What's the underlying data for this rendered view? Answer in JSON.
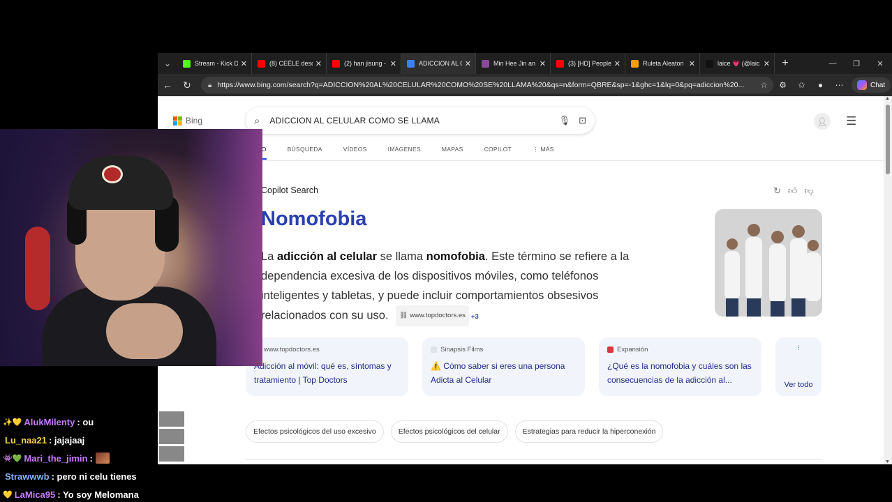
{
  "browser": {
    "tabs": [
      {
        "label": "Stream - Kick D",
        "color": "#53fc18",
        "active": false
      },
      {
        "label": "(8) CEÉLE descu",
        "color": "#ff0000",
        "active": false
      },
      {
        "label": "(2) han jisung -",
        "color": "#ff0000",
        "active": false
      },
      {
        "label": "ADICCION AL C",
        "color": "#3b82f6",
        "active": true
      },
      {
        "label": "Min Hee Jin an",
        "color": "#8a4a9a",
        "active": false
      },
      {
        "label": "(3) [HD] People",
        "color": "#ff0000",
        "active": false
      },
      {
        "label": "Ruleta Aleatori",
        "color": "#f59e0b",
        "active": false
      },
      {
        "label": "laice 💗 (@laic",
        "color": "#111111",
        "active": false
      }
    ],
    "url": "https://www.bing.com/search?q=ADICCION%20AL%20CELULAR%20COMO%20SE%20LLAMA%20&qs=n&form=QBRE&sp=-1&ghc=1&lq=0&pq=adiccion%20...",
    "chat_label": "Chat"
  },
  "bing": {
    "logo_text": "Bing",
    "query": "ADICCION AL CELULAR COMO SE LLAMA",
    "scopes": [
      "TODO",
      "BÚSQUEDA",
      "VÍDEOS",
      "IMÁGENES",
      "MAPAS",
      "COPILOT",
      "⋮ MÁS"
    ],
    "copilot_label": "Copilot Search",
    "answer_title": "Nomofobia",
    "answer_p1": "La ",
    "answer_b1": "adicción al celular",
    "answer_p2": " se llama ",
    "answer_b2": "nomofobia",
    "answer_p3": ". Este término se refiere a la dependencia excesiva de los dispositivos móviles, como teléfonos inteligentes y tabletas, y puede incluir comportamientos obsesivos relacionados con su uso.",
    "answer_source": "www.topdoctors.es",
    "answer_source_more": "+3",
    "cards": [
      {
        "source": "www.topdoctors.es",
        "title": "Adicción al móvil: qué es, síntomas y tratamiento | Top Doctors",
        "fav": "#e8eaf0"
      },
      {
        "source": "Sinapsis Films",
        "title": "⚠️ Cómo saber si eres una persona Adicta al Celular",
        "fav": "#dfe3ea"
      },
      {
        "source": "Expansión",
        "title": "¿Qué es la nomofobia y cuáles son las consecuencias de la adicción al...",
        "fav": "#d9363e"
      }
    ],
    "view_all": "Ver todo",
    "chips": [
      "Efectos psicológicos del uso excesivo",
      "Efectos psicológicos del celular",
      "Estrategias para reducir la hiperconexión"
    ]
  },
  "chat": [
    {
      "badge": "✨💛",
      "user": "AlukMilenty",
      "user_color": "#c77dff",
      "text": ": ou",
      "emote": false
    },
    {
      "badge": "",
      "user": "Lu_naa21",
      "user_color": "#f7d24a",
      "text": ": jajajaaj",
      "emote": false
    },
    {
      "badge": "👾💚",
      "user": "Mari_the_jimin",
      "user_color": "#c77dff",
      "text": ":",
      "emote": true
    },
    {
      "badge": "",
      "user": "Strawwwb",
      "user_color": "#7fb3ff",
      "text": ": pero ni celu tienes",
      "emote": false
    },
    {
      "badge": "💛",
      "user": "LaMica95",
      "user_color": "#c77dff",
      "text": ": Yo soy Melomana",
      "emote": false
    }
  ]
}
